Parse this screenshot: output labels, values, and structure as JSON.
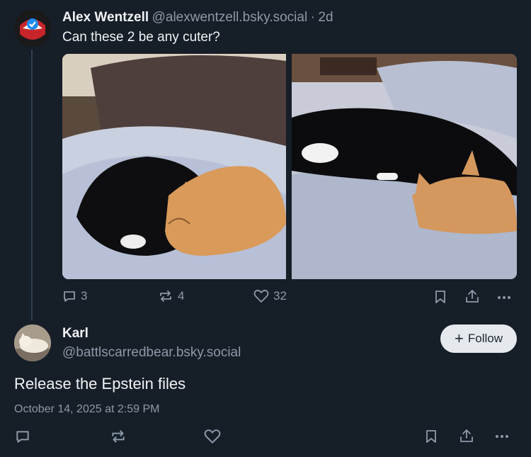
{
  "post": {
    "author_name": "Alex Wentzell",
    "author_handle": "@alexwentzell.bsky.social",
    "separator": "·",
    "time": "2d",
    "text": "Can these 2 be any cuter?",
    "reply_count": "3",
    "repost_count": "4",
    "like_count": "32"
  },
  "reply": {
    "author_name": "Karl",
    "author_handle": "@battlscarredbear.bsky.social",
    "follow_label": "Follow",
    "text": "Release the Epstein files",
    "timestamp": "October 14, 2025 at 2:59 PM"
  },
  "icons": [
    "reply-icon",
    "repost-icon",
    "like-icon",
    "bookmark-icon",
    "share-icon",
    "more-icon"
  ],
  "colors": {
    "background": "#161e27",
    "secondary_text": "#8c9aa9",
    "follow_button": "#e5e9ee"
  }
}
